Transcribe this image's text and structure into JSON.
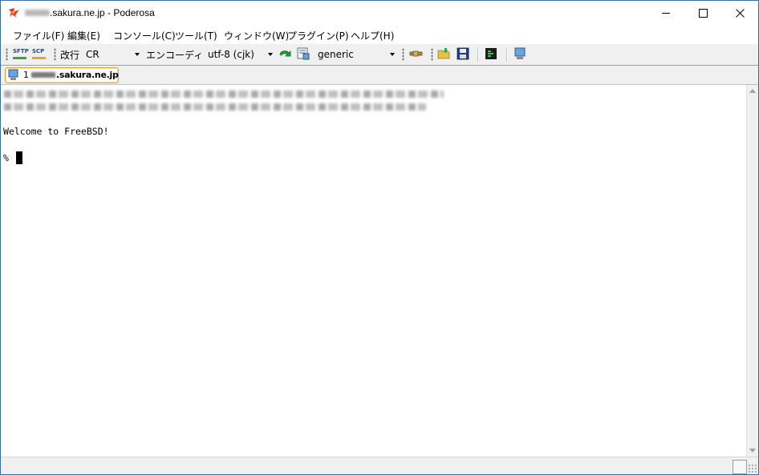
{
  "window": {
    "title": ".sakura.ne.jp - Poderosa",
    "app_icon": "poderosa-icon",
    "buttons": {
      "minimize": "minimize-icon",
      "maximize": "maximize-icon",
      "close": "close-icon"
    }
  },
  "menu": [
    {
      "label": "ファイル(F)"
    },
    {
      "label": "編集(E)"
    },
    {
      "label": "コンソール(C)"
    },
    {
      "label": "ツール(T)"
    },
    {
      "label": "ウィンドウ(W)"
    },
    {
      "label": "プラグイン(P)"
    },
    {
      "label": "ヘルプ(H)"
    }
  ],
  "toolbar": {
    "sftp_label": "SFTP",
    "scp_label": "SCP",
    "newline_label": "改行",
    "newline_value": "CR",
    "encoding_label": "エンコーディング",
    "encoding_value": "utf-8 (cjk)",
    "terminal_type_value": "generic",
    "colors": {
      "sftp_bar": "#3aa34a",
      "scp_bar": "#e0a43c"
    }
  },
  "tab": {
    "number": "1",
    "label": ".sakura.ne.jp"
  },
  "terminal": {
    "lines": [
      "Welcome to FreeBSD!",
      "%"
    ]
  }
}
